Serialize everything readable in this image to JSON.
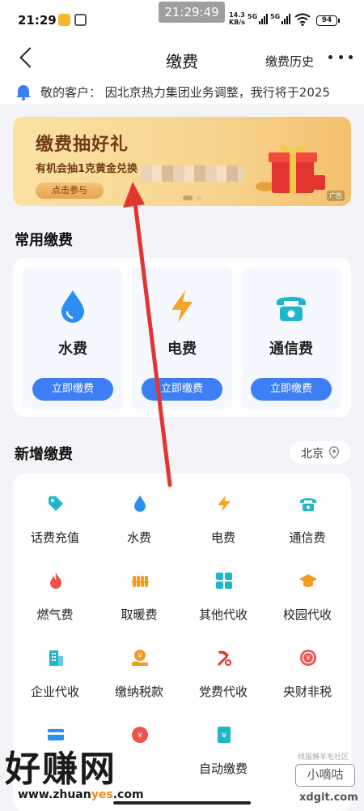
{
  "status_bar": {
    "time": "21:29",
    "overlay_time": "21:29:49",
    "net_speed_value": "14.3",
    "net_speed_unit": "KB/s",
    "signal1_label": "5G",
    "signal2_label": "5G",
    "battery": "94"
  },
  "nav": {
    "title": "缴费",
    "history_label": "缴费历史"
  },
  "notice": {
    "text": "敬的客户：  因北京热力集团业务调整，我行将于2025"
  },
  "banner": {
    "title": "缴费抽好礼",
    "subtitle": "有机会抽1克黄金兑换",
    "button_label": "点击参与",
    "ad_tag": "广告"
  },
  "common_section": {
    "title": "常用缴费",
    "tiles": [
      {
        "label": "水费",
        "icon": "water-drop-icon",
        "button_label": "立即缴费"
      },
      {
        "label": "电费",
        "icon": "lightning-icon",
        "button_label": "立即缴费"
      },
      {
        "label": "通信费",
        "icon": "phone-icon",
        "button_label": "立即缴费"
      }
    ]
  },
  "new_section": {
    "title": "新增缴费",
    "location": "北京",
    "items": [
      {
        "label": "话费充值",
        "icon": "tag-icon"
      },
      {
        "label": "水费",
        "icon": "water-drop-icon"
      },
      {
        "label": "电费",
        "icon": "lightning-icon"
      },
      {
        "label": "通信费",
        "icon": "phone-icon"
      },
      {
        "label": "燃气费",
        "icon": "flame-icon"
      },
      {
        "label": "取暖费",
        "icon": "radiator-icon"
      },
      {
        "label": "其他代收",
        "icon": "grid-icon"
      },
      {
        "label": "校园代收",
        "icon": "graduation-cap-icon"
      },
      {
        "label": "企业代收",
        "icon": "building-icon"
      },
      {
        "label": "缴纳税款",
        "icon": "tax-hand-icon"
      },
      {
        "label": "党费代收",
        "icon": "party-emblem-icon"
      },
      {
        "label": "央财非税",
        "icon": "finance-seal-icon"
      },
      {
        "label": "",
        "icon": "card-icon"
      },
      {
        "label": "",
        "icon": "fine-icon"
      },
      {
        "label": "自动缴费",
        "icon": "auto-pay-icon"
      },
      {
        "label": "",
        "icon": ""
      }
    ]
  },
  "watermark": {
    "big": "好赚网",
    "url_prefix": "www.zhuan",
    "url_highlight": "yes",
    "url_suffix": ".com",
    "small_text": "线报薅羊毛社区",
    "box_text": "小嘀咕",
    "url2": "xdgit.com"
  },
  "colors": {
    "primary": "#3d7ef5",
    "water": "#2b8ef0",
    "electric": "#f5a623",
    "teal": "#1fb6c9",
    "red": "#f0524a",
    "orange": "#f29a1f"
  }
}
